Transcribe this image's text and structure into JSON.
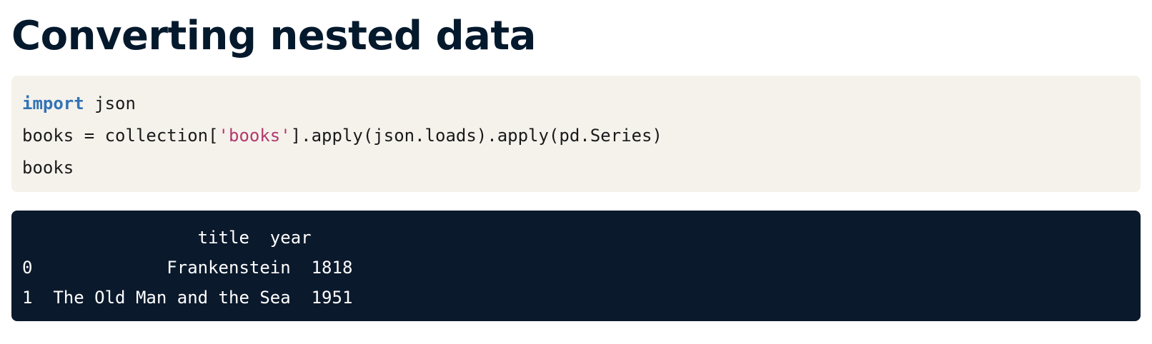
{
  "page": {
    "title": "Converting nested data"
  },
  "code_cell": {
    "lines": [
      {
        "keyword": "import",
        "rest": " json"
      },
      {
        "before": "books = collection[",
        "string": "'books'",
        "after": "].apply(json.loads).apply(pd.Series)"
      },
      {
        "text": "books"
      }
    ]
  },
  "output_cell": {
    "lines": [
      "                 title  year",
      "0         Frankenstein  1818",
      "1  The Old Man and the Sea  1951"
    ],
    "table": {
      "columns": [
        "title",
        "year"
      ],
      "rows": [
        {
          "index": "0",
          "title": "Frankenstein",
          "year": "1818"
        },
        {
          "index": "1",
          "title": "The Old Man and the Sea",
          "year": "1951"
        }
      ]
    }
  },
  "colors": {
    "title": "#05192d",
    "code_background": "#f5f2ec",
    "output_background": "#0b192c",
    "keyword": "#3273b5",
    "string": "#b3386e"
  }
}
